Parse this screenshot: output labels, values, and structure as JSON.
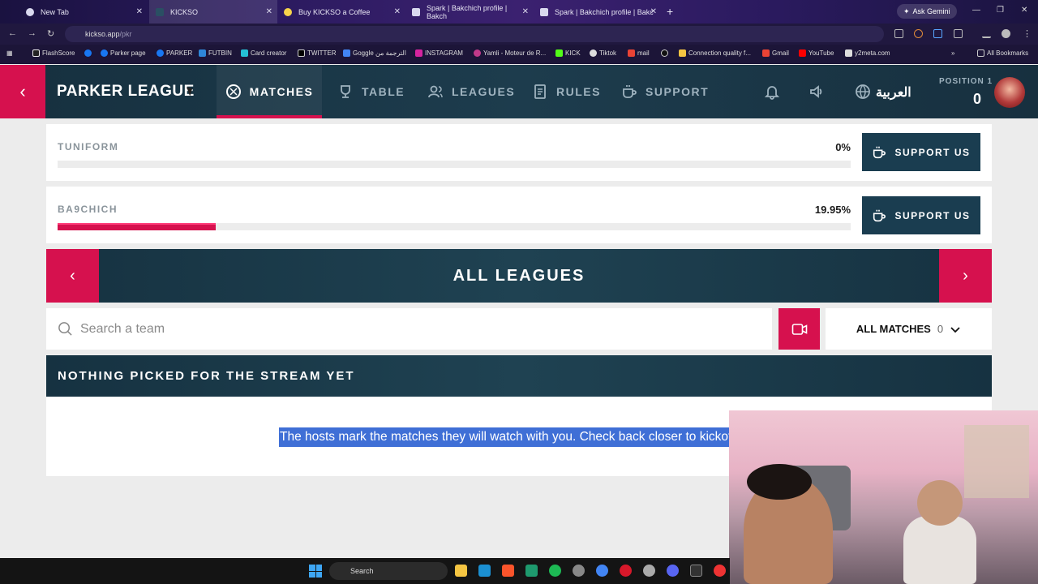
{
  "browser": {
    "tabs": [
      {
        "title": "New Tab",
        "active": false
      },
      {
        "title": "KICKSO",
        "active": true
      },
      {
        "title": "Buy KICKSO a Coffee",
        "active": false
      },
      {
        "title": "Spark | Bakchich profile | Bakch",
        "active": false
      },
      {
        "title": "Spark | Bakchich profile | Bakc",
        "active": false
      }
    ],
    "gemini_label": "Ask Gemini",
    "url_domain": "kickso.app",
    "url_path": "/pkr",
    "bookmarks": [
      "FlashScore",
      "Parker page",
      "PARKER",
      "FUTBIN",
      "Card creator",
      "TWITTER",
      "Goggle الترجمة من",
      "INSTAGRAM",
      "Yamli - Moteur de R...",
      "KICK",
      "Tiktok",
      "mail",
      "Connection quality f...",
      "Gmail",
      "YouTube",
      "y2meta.com"
    ],
    "all_bookmarks_label": "All Bookmarks"
  },
  "header": {
    "brand": "PARKER LEAGUE",
    "nav": [
      {
        "label": "MATCHES",
        "active": true
      },
      {
        "label": "TABLE",
        "active": false
      },
      {
        "label": "LEAGUES",
        "active": false
      },
      {
        "label": "RULES",
        "active": false
      },
      {
        "label": "SUPPORT",
        "active": false
      }
    ],
    "language": "العربية",
    "position_label": "POSITION 1",
    "position_value": "0"
  },
  "support_cards": [
    {
      "name": "TUNIFORM",
      "percent_label": "0%",
      "progress": 0,
      "button": "SUPPORT US"
    },
    {
      "name": "BA9CHICH",
      "percent_label": "19.95%",
      "progress": 0.1995,
      "button": "SUPPORT US"
    }
  ],
  "leagues_banner": {
    "title": "ALL LEAGUES"
  },
  "search": {
    "placeholder": "Search a team"
  },
  "filter": {
    "label": "ALL MATCHES",
    "count": "0"
  },
  "stream": {
    "title": "NOTHING PICKED FOR THE STREAM YET",
    "hint": "The hosts mark the matches they will watch with you. Check back closer to kickoff"
  },
  "taskbar": {
    "search_label": "Search"
  },
  "colors": {
    "accent": "#d6114e",
    "header_bg": "#1d3c4d",
    "button_bg": "#1a3d50",
    "selection": "#3f6fd6"
  }
}
